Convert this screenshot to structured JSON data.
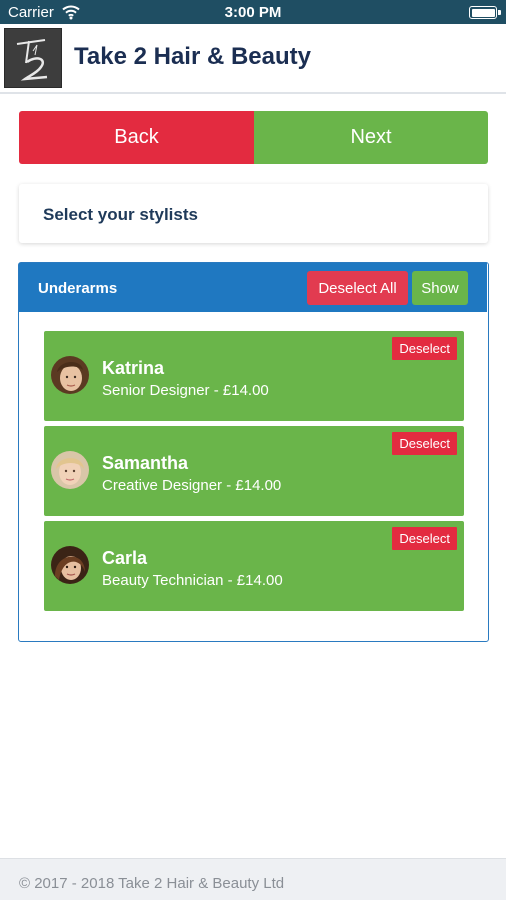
{
  "status_bar": {
    "carrier": "Carrier",
    "time": "3:00 PM",
    "icons": [
      "wifi-icon",
      "battery-icon"
    ]
  },
  "header": {
    "title": "Take 2 Hair & Beauty",
    "logo_text": "T2"
  },
  "nav": {
    "back_label": "Back",
    "next_label": "Next"
  },
  "page": {
    "heading": "Select your stylists"
  },
  "service": {
    "name": "Underarms",
    "deselect_all_label": "Deselect All",
    "show_label": "Show",
    "stylists": [
      {
        "name": "Katrina",
        "role": "Senior Designer - £14.00",
        "deselect_label": "Deselect"
      },
      {
        "name": "Samantha",
        "role": "Creative Designer - £14.00",
        "deselect_label": "Deselect"
      },
      {
        "name": "Carla",
        "role": "Beauty Technician - £14.00",
        "deselect_label": "Deselect"
      }
    ]
  },
  "footer": {
    "copyright": "© 2017 - 2018 Take 2 Hair & Beauty Ltd"
  },
  "colors": {
    "status_bar": "#1f4e63",
    "primary_text": "#1b2e52",
    "danger": "#e32b40",
    "success": "#6ab54a",
    "panel_header": "#1f78c1",
    "footer_bg": "#eef0f3"
  }
}
